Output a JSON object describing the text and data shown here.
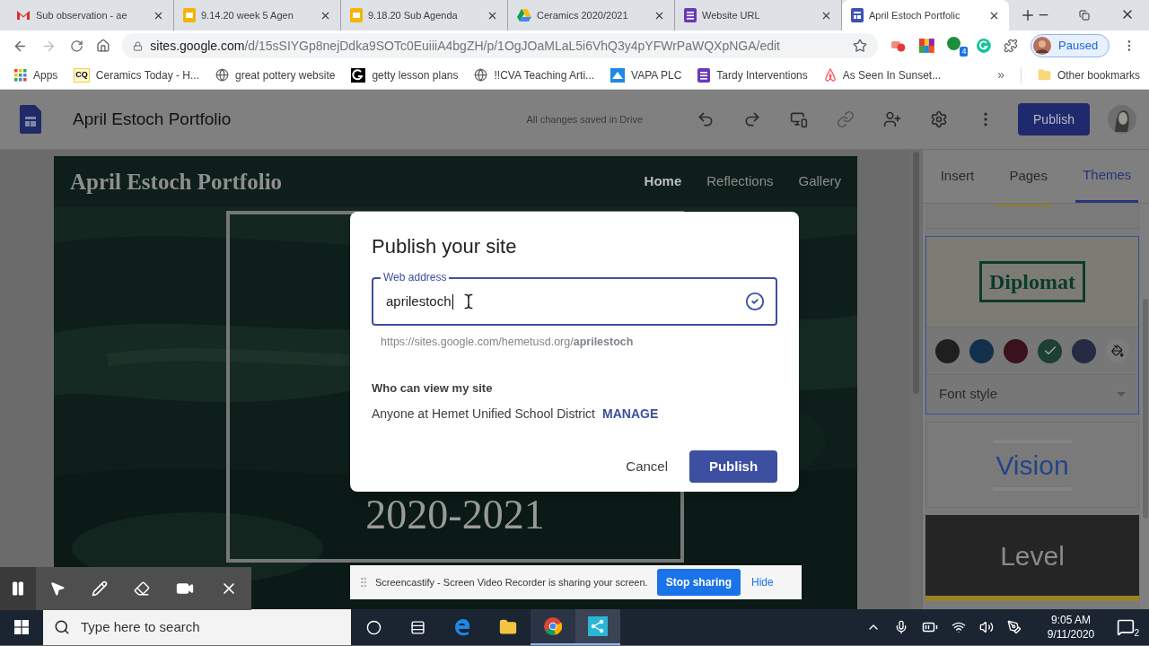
{
  "browser": {
    "tabs": [
      {
        "kind": "gmail",
        "title": "Sub observation - ae",
        "selected": false
      },
      {
        "kind": "slides",
        "title": "9.14.20 week 5 Agen",
        "selected": false
      },
      {
        "kind": "slides",
        "title": "9.18.20 Sub Agenda",
        "selected": false
      },
      {
        "kind": "drive",
        "title": "Ceramics 2020/2021",
        "selected": false
      },
      {
        "kind": "forms",
        "title": "Website URL",
        "selected": false
      },
      {
        "kind": "sites",
        "title": "April Estoch Portfolic",
        "selected": true
      }
    ],
    "url_host": "sites.google.com",
    "url_path": "/d/15sSIYGp8nejDdka9SOTc0EuiiiA4bgZH/p/1OgJOaMLaL5i6VhQ3y4pYFWrPaWQXpNGA/edit",
    "extension_badge": "4",
    "profile_status": "Paused",
    "bookmarks": [
      {
        "kind": "apps",
        "label": "Apps"
      },
      {
        "kind": "cq",
        "icon_text": "CQ",
        "label": "Ceramics Today - H..."
      },
      {
        "kind": "globe",
        "label": "great pottery website"
      },
      {
        "kind": "getty",
        "label": "getty lesson plans"
      },
      {
        "kind": "globe",
        "label": "!!CVA Teaching Arti..."
      },
      {
        "kind": "vapa",
        "label": "VAPA PLC"
      },
      {
        "kind": "forms",
        "label": "Tardy Interventions"
      },
      {
        "kind": "airbnb",
        "label": "As Seen In Sunset..."
      }
    ],
    "bookmarks_more": "»",
    "other_bookmarks": "Other bookmarks"
  },
  "editor": {
    "title": "April Estoch Portfolio",
    "save_status": "All changes saved in Drive",
    "publish": "Publish"
  },
  "site": {
    "title": "April Estoch Portfolio",
    "nav": [
      {
        "label": "Home",
        "selected": true
      },
      {
        "label": "Reflections",
        "selected": false
      },
      {
        "label": "Gallery",
        "selected": false
      }
    ],
    "hero_year": "2020-2021"
  },
  "panel": {
    "tabs": [
      {
        "label": "Insert",
        "selected": false
      },
      {
        "label": "Pages",
        "selected": false
      },
      {
        "label": "Themes",
        "selected": true
      }
    ],
    "themes": [
      {
        "kind": "diplomat",
        "name": "Diplomat",
        "selected": true,
        "font_style": "Font style",
        "swatches": [
          {
            "color": "#1f1f1f",
            "selected": false
          },
          {
            "color": "#12304a",
            "selected": false
          },
          {
            "color": "#3a121d",
            "selected": false
          },
          {
            "color": "#1d4032",
            "selected": true
          },
          {
            "color": "#262a44",
            "selected": false
          }
        ]
      },
      {
        "kind": "vision",
        "name": "Vision",
        "selected": false
      },
      {
        "kind": "level",
        "name": "Level",
        "selected": false
      }
    ]
  },
  "dialog": {
    "title": "Publish your site",
    "field_label": "Web address",
    "value": "aprilestoch",
    "url_preview": "https://sites.google.com/hemetusd.org/**aprilestoch**",
    "who_heading": "Who can view my site",
    "who_text": "Anyone at Hemet Unified School District",
    "manage": "MANAGE",
    "cancel": "Cancel",
    "publish": "Publish"
  },
  "share_bar": {
    "message": "Screencastify - Screen Video Recorder is sharing your screen.",
    "stop": "Stop sharing",
    "hide": "Hide"
  },
  "taskbar": {
    "search_placeholder": "Type here to search",
    "time": "9:05 AM",
    "date": "9/11/2020",
    "notifications": "2"
  }
}
